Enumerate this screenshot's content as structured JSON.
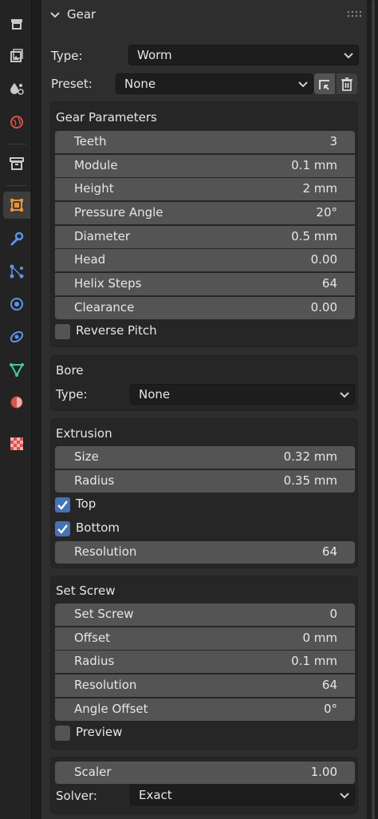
{
  "tabs": [
    {
      "icon": "tool-icon",
      "active": false
    },
    {
      "icon": "render-icon",
      "active": false
    },
    {
      "icon": "output-icon",
      "active": false
    },
    {
      "icon": "view-layer-icon",
      "active": false
    },
    {
      "icon": "scene-icon",
      "active": false
    },
    {
      "icon": "world-icon",
      "active": false
    },
    {
      "icon": "collection-icon",
      "active": false
    },
    {
      "icon": "object-icon",
      "active": true
    },
    {
      "icon": "modifier-icon",
      "active": false
    },
    {
      "icon": "particles-icon",
      "active": false
    },
    {
      "icon": "physics-icon",
      "active": false
    },
    {
      "icon": "constraints-icon",
      "active": false
    },
    {
      "icon": "data-icon",
      "active": false
    },
    {
      "icon": "material-icon",
      "active": false
    },
    {
      "icon": "texture-icon",
      "active": false
    }
  ],
  "panel": {
    "title": "Gear",
    "type_label": "Type:",
    "type_value": "Worm",
    "preset_label": "Preset:",
    "preset_value": "None"
  },
  "gear_parameters": {
    "title": "Gear Parameters",
    "fields": [
      {
        "name": "Teeth",
        "value": "3"
      },
      {
        "name": "Module",
        "value": "0.1 mm"
      },
      {
        "name": "Height",
        "value": "2 mm"
      },
      {
        "name": "Pressure Angle",
        "value": "20°"
      },
      {
        "name": "Diameter",
        "value": "0.5 mm"
      },
      {
        "name": "Head",
        "value": "0.00"
      },
      {
        "name": "Helix Steps",
        "value": "64"
      },
      {
        "name": "Clearance",
        "value": "0.00"
      }
    ],
    "reverse_pitch": {
      "label": "Reverse Pitch",
      "checked": false
    }
  },
  "bore": {
    "title": "Bore",
    "type_label": "Type:",
    "type_value": "None"
  },
  "extrusion": {
    "title": "Extrusion",
    "fields": [
      {
        "name": "Size",
        "value": "0.32 mm"
      },
      {
        "name": "Radius",
        "value": "0.35 mm"
      }
    ],
    "top": {
      "label": "Top",
      "checked": true
    },
    "bottom": {
      "label": "Bottom",
      "checked": true
    },
    "resolution": {
      "name": "Resolution",
      "value": "64"
    }
  },
  "set_screw": {
    "title": "Set Screw",
    "fields": [
      {
        "name": "Set Screw",
        "value": "0"
      },
      {
        "name": "Offset",
        "value": "0 mm"
      },
      {
        "name": "Radius",
        "value": "0.1 mm"
      },
      {
        "name": "Resolution",
        "value": "64"
      },
      {
        "name": "Angle Offset",
        "value": "0°"
      }
    ],
    "preview": {
      "label": "Preview",
      "checked": false
    }
  },
  "scaler_box": {
    "scaler": {
      "name": "Scaler",
      "value": "1.00"
    },
    "solver_label": "Solver:",
    "solver_value": "Exact"
  },
  "colors": {
    "accent": "#4772b3",
    "panel_bg": "#2e2e2e",
    "field_bg": "#545454"
  }
}
